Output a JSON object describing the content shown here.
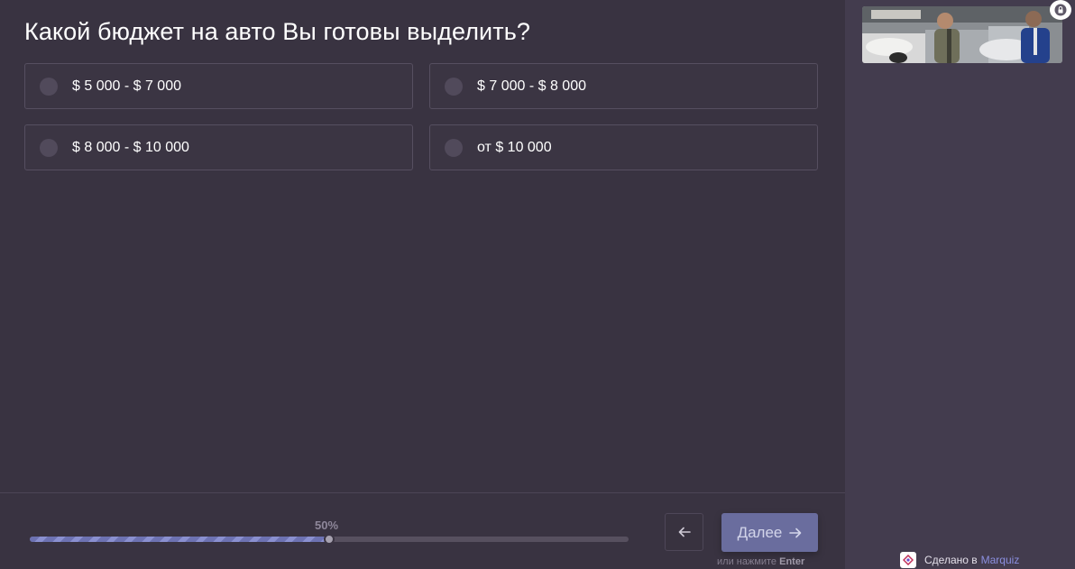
{
  "question": "Какой бюджет на авто Вы готовы выделить?",
  "options": [
    {
      "label": "$ 5 000 - $ 7 000"
    },
    {
      "label": "$ 7 000 - $ 8 000"
    },
    {
      "label": "$ 8 000 - $ 10 000"
    },
    {
      "label": "от $ 10 000"
    }
  ],
  "progress": {
    "label": "50%",
    "value_fraction": 0.5
  },
  "nav": {
    "next_label": "Далее",
    "hint_prefix": "или нажмите",
    "hint_key": "Enter"
  },
  "footer": {
    "made_by": "Сделано в",
    "brand": "Marquiz"
  },
  "icons": {
    "back": "arrow-left-icon",
    "next": "arrow-right-icon",
    "lock": "lock-icon",
    "logo": "marquiz-logo-icon"
  },
  "colors": {
    "background": "#393341",
    "sidebar": "#433c4e",
    "accent": "#6a6d9e",
    "brand_link": "#8b8fe0"
  }
}
